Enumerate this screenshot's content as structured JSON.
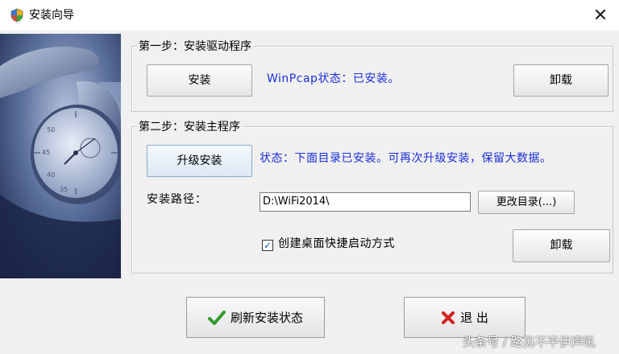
{
  "window": {
    "title": "安装向导",
    "close_glyph": "✕"
  },
  "step1": {
    "title": "第一步：安装驱动程序",
    "install_button": "安装",
    "status": "WinPcap状态：已安装。",
    "uninstall_button": "卸载"
  },
  "step2": {
    "title": "第二步：安装主程序",
    "upgrade_button": "升级安装",
    "status": "状态：下面目录已安装。可再次升级安装，保留大数据。",
    "path_label": "安装路径：",
    "path_value": "D:\\WiFi2014\\",
    "change_dir_button": "更改目录(...)",
    "shortcut_checkbox": {
      "checked": true,
      "label": "创建桌面快捷启动方式"
    },
    "uninstall_button": "卸载"
  },
  "footer": {
    "refresh_button": "刷新安装状态",
    "exit_button": "退 出"
  },
  "watermark": "头条号 / 路见不平伊声吼",
  "colors": {
    "status_blue": "#1a2fd8",
    "check_green": "#2e9a2e",
    "cross_red": "#d32020"
  },
  "icons": [
    "shield-icon",
    "close-icon",
    "checkmark-icon",
    "cross-icon"
  ]
}
